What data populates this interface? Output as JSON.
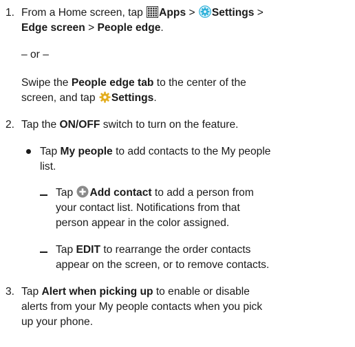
{
  "steps": [
    {
      "number": "1.",
      "line1": {
        "pre": "From a Home screen, tap ",
        "apps": "Apps",
        "sep1": " > ",
        "settings": "Settings",
        "sep2": " >"
      },
      "line2": {
        "edge_screen": "Edge screen",
        "sep": " > ",
        "people_edge": "People edge",
        "end": "."
      },
      "or_text": "– or –",
      "alt_line1": {
        "pre": "Swipe the ",
        "tab": "People edge tab",
        "post": " to the center of the"
      },
      "alt_line2": {
        "pre": "screen, and tap ",
        "settings": "Settings",
        "end": "."
      }
    },
    {
      "number": "2.",
      "line1": {
        "pre": "Tap the ",
        "switch": "ON/OFF",
        "post": " switch to turn on the feature."
      },
      "bullet": {
        "line1": {
          "pre": "Tap ",
          "bold": "My people",
          "post": " to add contacts to the My people"
        },
        "line2": "list."
      },
      "sub1": {
        "line1": {
          "pre": "Tap ",
          "bold": "Add contact",
          "post": " to add a person from"
        },
        "line2": "your contact list. Notifications from that",
        "line3": "person appear in the color assigned."
      },
      "sub2": {
        "line1": {
          "pre": "Tap ",
          "bold": "EDIT",
          "post": " to rearrange the order contacts"
        },
        "line2": "appear on the screen, or to remove contacts."
      }
    },
    {
      "number": "3.",
      "line1": {
        "pre": "Tap ",
        "bold": "Alert when picking up",
        "post": " to enable or disable"
      },
      "line2": "alerts from your My people contacts when you pick",
      "line3": "up your phone."
    }
  ],
  "icons": {
    "apps": "apps-grid-icon",
    "settings": "settings-gear-icon",
    "add": "add-circle-icon"
  },
  "colors": {
    "text": "#1a1a1a",
    "settings_icon": "#2bb0d9",
    "gear_icon": "#e3ad1f",
    "add_icon": "#8a8a8a"
  }
}
